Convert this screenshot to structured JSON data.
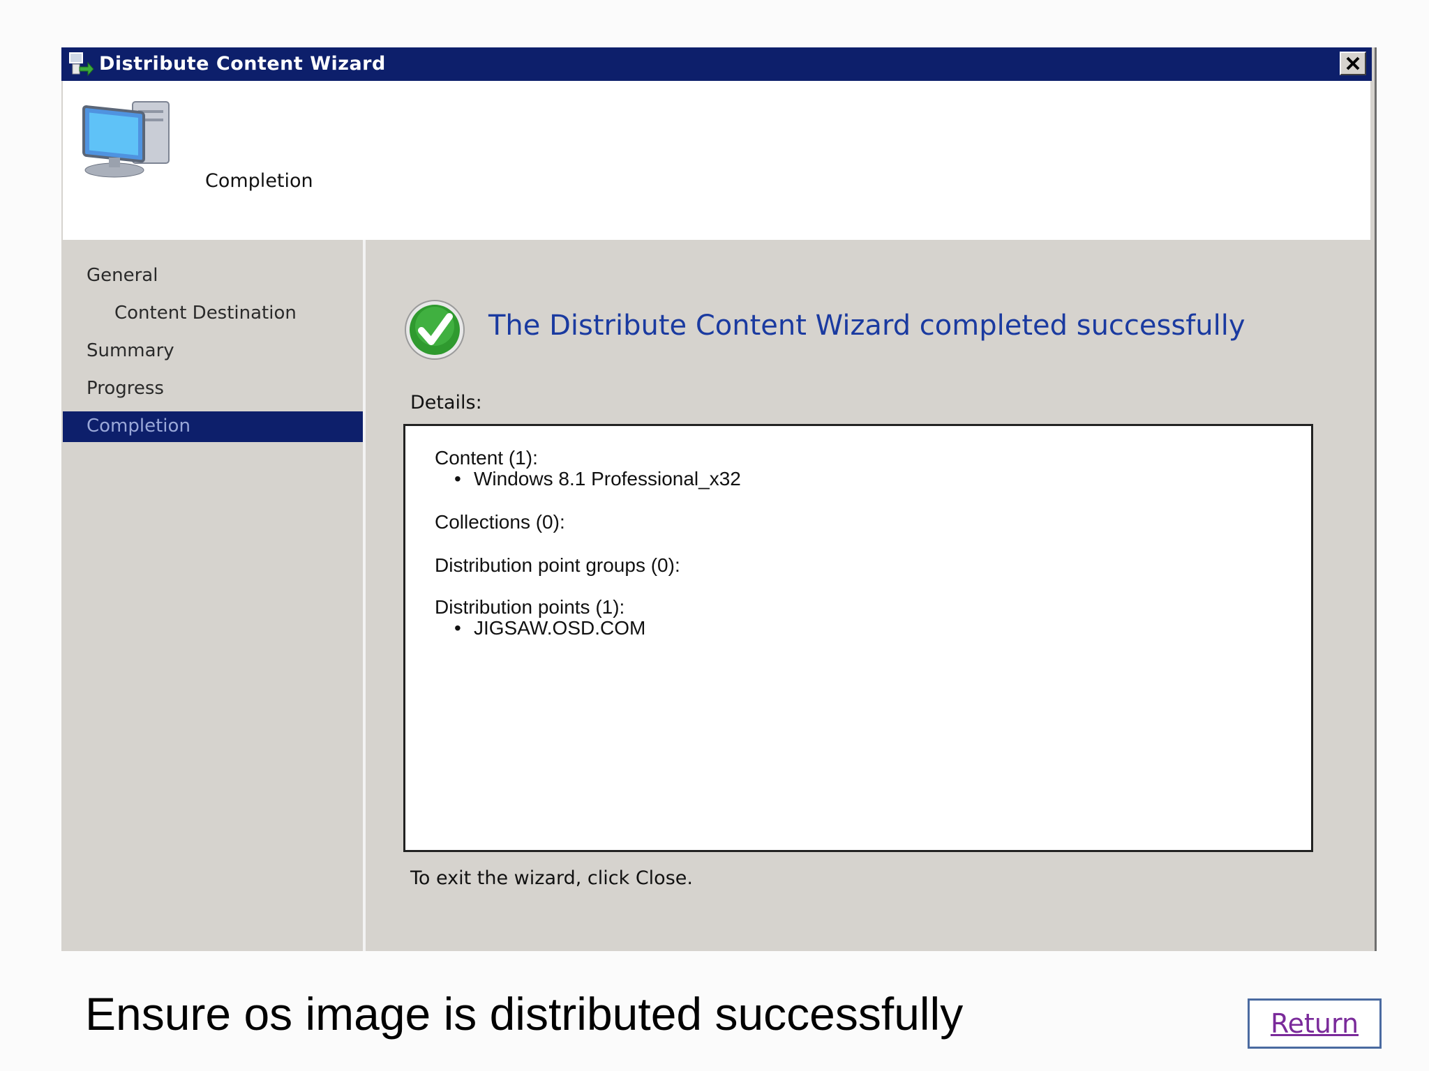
{
  "window": {
    "title": "Distribute Content Wizard",
    "icon": "wizard-computer-icon",
    "close_label": "✕"
  },
  "header": {
    "page_title": "Completion",
    "icon": "computer-monitor-icon"
  },
  "nav": {
    "items": [
      {
        "label": "General",
        "indent": false,
        "active": false
      },
      {
        "label": "Content Destination",
        "indent": true,
        "active": false
      },
      {
        "label": "Summary",
        "indent": false,
        "active": false
      },
      {
        "label": "Progress",
        "indent": false,
        "active": false
      },
      {
        "label": "Completion",
        "indent": false,
        "active": true
      }
    ]
  },
  "main": {
    "success_title": "The Distribute Content Wizard completed successfully",
    "status_icon": "green-checkmark-icon",
    "details_label": "Details:",
    "details": {
      "content_header": "Content (1):",
      "content_item": "Windows 8.1 Professional_x32",
      "collections_header": "Collections (0):",
      "dp_groups_header": "Distribution point groups (0):",
      "dp_header": "Distribution points (1):",
      "dp_item": "JIGSAW.OSD.COM",
      "bullet": "•"
    },
    "exit_text": "To exit the wizard, click Close."
  },
  "slide": {
    "caption": "Ensure os image is distributed successfully",
    "return_label": "Return"
  },
  "colors": {
    "titlebar": "#0d1f6b",
    "panel": "#d6d3ce",
    "success_text": "#1a3aa0",
    "link": "#7a2a9a"
  }
}
